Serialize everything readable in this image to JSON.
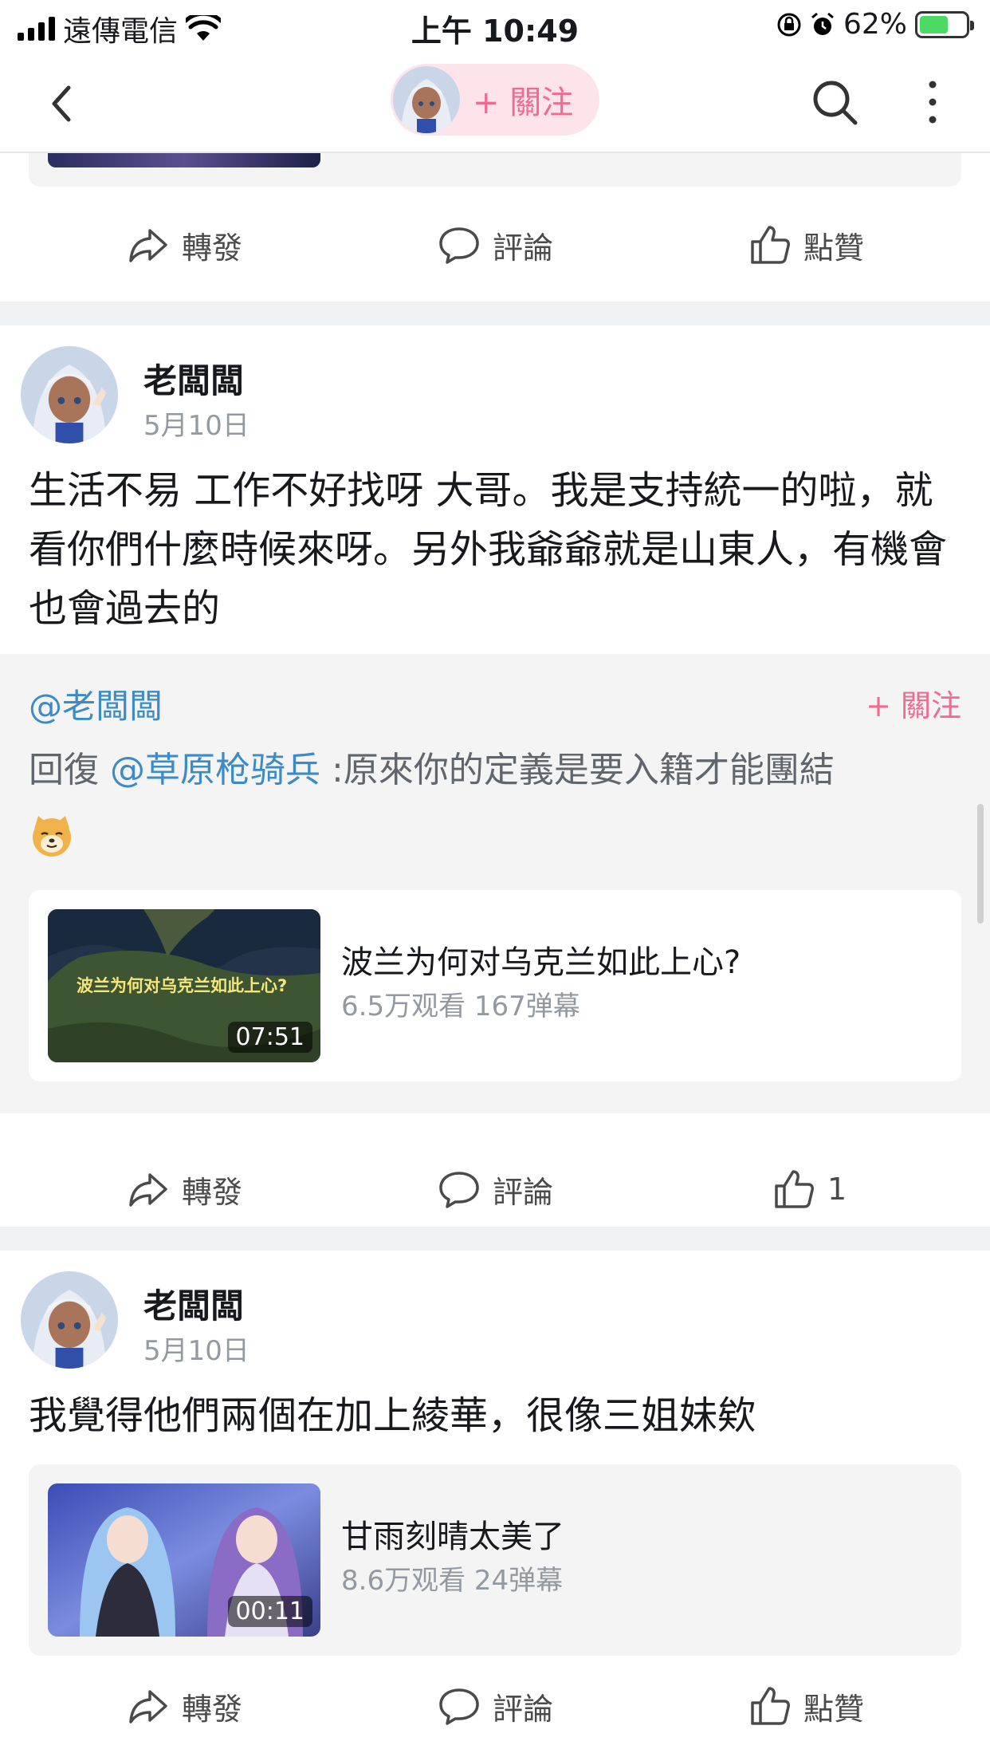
{
  "status_bar": {
    "carrier": "遠傳電信",
    "time": "上午 10:49",
    "battery": "62%",
    "battery_level": 0.62
  },
  "nav": {
    "follow_label": "+ 關注"
  },
  "actions": {
    "share": "轉發",
    "comment": "評論",
    "like": "點贊"
  },
  "posts": [
    {
      "author": "老闆闆",
      "date": "5月10日",
      "content": "生活不易 工作不好找呀 大哥。我是支持統一的啦，就看你們什麼時候來呀。另外我爺爺就是山東人，有機會也會過去的",
      "repost": {
        "author": "@老闆闆",
        "follow": "+ 關注",
        "reply_prefix": "回復",
        "mention": "@草原枪骑兵",
        "reply_text": ":原來你的定義是要入籍才能團結",
        "emoji": "doge-emoji"
      },
      "video": {
        "title": "波兰为何对乌克兰如此上心?",
        "stats": "6.5万观看 167弹幕",
        "duration": "07:51",
        "thumb_caption": "波兰为何对乌克兰如此上心?"
      },
      "like_count": "1"
    },
    {
      "author": "老闆闆",
      "date": "5月10日",
      "content": "我覺得他們兩個在加上綾華，很像三姐妹欸",
      "video": {
        "title": "甘雨刻晴太美了",
        "stats": "8.6万观看 24弹幕",
        "duration": "00:11"
      }
    }
  ],
  "colors": {
    "accent_pink": "#ef6b8f",
    "mention_blue": "#3a8bc8"
  }
}
